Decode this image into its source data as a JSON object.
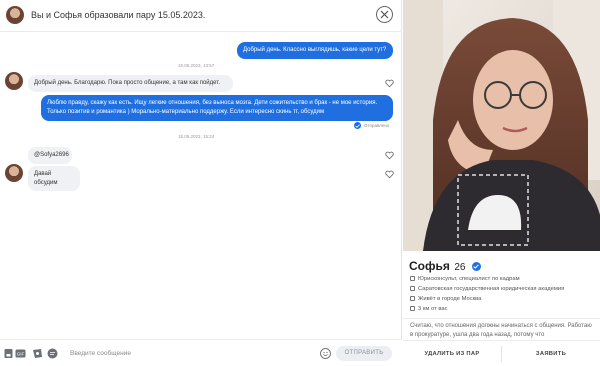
{
  "header": {
    "title": "Вы и Софья образовали пару 15.05.2023."
  },
  "messages": [
    {
      "type": "out",
      "text": "Добрый день. Классно выглядишь, какие цели тут?"
    },
    {
      "type": "timestamp",
      "text": "15.05.2023, 13:57"
    },
    {
      "type": "in",
      "text": "Добрый день. Благодарю. Пока просто общение, а там как пойдет."
    },
    {
      "type": "out",
      "text": "Люблю правду, скажу как есть. Ищу легкие отношения, без выноса мозга. Дети сожительство и брак - не мое история. Только позитив и романтика ) Морально-материально поддержу. Если интересно скинь тг, обсудим",
      "status": "Отправлено"
    },
    {
      "type": "timestamp",
      "text": "15.05.2023, 15:24"
    },
    {
      "type": "in",
      "text": "@Sofya2696"
    },
    {
      "type": "in",
      "text": "Давай обсудим"
    }
  ],
  "composer": {
    "placeholder": "Введите сообщение",
    "send_label": "ОТПРАВИТЬ",
    "gif_label": "GIF"
  },
  "profile": {
    "name": "Софья",
    "age": "26",
    "details": [
      "Юрисконсульт, специалист по кадрам",
      "Саратовская государственная юридическая академия",
      "Живёт в городе Москва",
      "3 км от вас"
    ],
    "bio": "Считаю, что отношения должны начинаться с общения. Работаю в прокуратуре, ушла два года назад, потому что",
    "unmatch_label": "УДАЛИТЬ ИЗ ПАР",
    "report_label": "ЗАЯВИТЬ"
  },
  "colors": {
    "accent": "#1f6fe0",
    "incoming_bubble": "#f0f1f4"
  }
}
